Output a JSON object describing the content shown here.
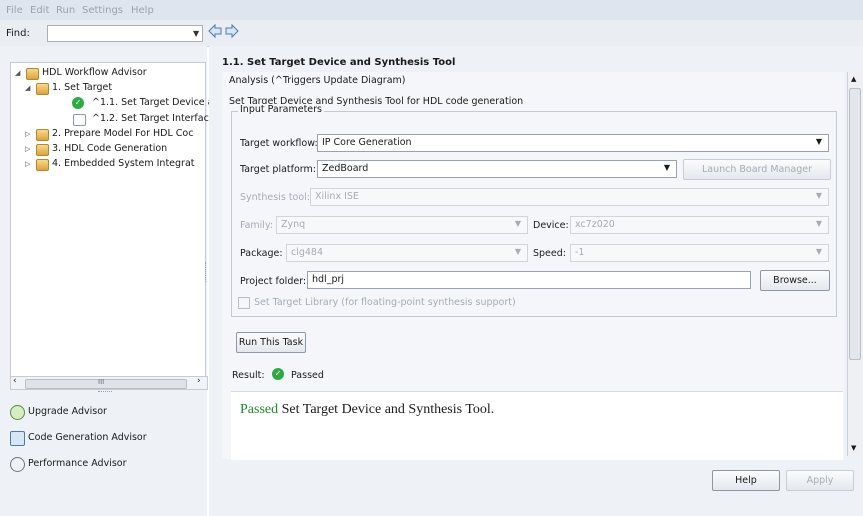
{
  "menu": {
    "items": [
      "File",
      "Edit",
      "Run",
      "Settings",
      "Help"
    ]
  },
  "find": {
    "label": "Find:",
    "value": ""
  },
  "tree": {
    "root": "HDL Workflow Advisor",
    "items": [
      {
        "label": "1. Set Target"
      },
      {
        "label": "^1.1. Set Target Device a"
      },
      {
        "label": "^1.2. Set Target Interfac"
      },
      {
        "label": "2. Prepare Model For HDL Coc"
      },
      {
        "label": "3. HDL Code Generation"
      },
      {
        "label": "4. Embedded System Integrat"
      }
    ],
    "scroll_marker": "III"
  },
  "advisors": [
    {
      "label": "Upgrade Advisor"
    },
    {
      "label": "Code Generation Advisor"
    },
    {
      "label": "Performance Advisor"
    }
  ],
  "task": {
    "title": "1.1. Set Target Device and Synthesis Tool",
    "analysis": "Analysis (^Triggers Update Diagram)",
    "description": "Set Target Device and Synthesis Tool for HDL code generation",
    "group_title": "Input Parameters"
  },
  "params": {
    "target_workflow": {
      "label": "Target workflow:",
      "value": "IP Core Generation"
    },
    "target_platform": {
      "label": "Target platform:",
      "value": "ZedBoard"
    },
    "launch_board_manager": "Launch Board Manager",
    "synthesis_tool": {
      "label": "Synthesis tool:",
      "value": "Xilinx ISE"
    },
    "family": {
      "label": "Family:",
      "value": "Zynq"
    },
    "device": {
      "label": "Device:",
      "value": "xc7z020"
    },
    "package": {
      "label": "Package:",
      "value": "clg484"
    },
    "speed": {
      "label": "Speed:",
      "value": "-1"
    },
    "project_folder": {
      "label": "Project folder:",
      "value": "hdl_prj"
    },
    "browse": "Browse...",
    "target_library": "Set Target Library (for floating-point synthesis support)"
  },
  "run_button": "Run This Task",
  "result": {
    "label": "Result:",
    "status": "Passed",
    "message_status": "Passed",
    "message_text": "Set Target Device and Synthesis Tool."
  },
  "footer": {
    "help": "Help",
    "apply": "Apply"
  },
  "colors": {
    "pass_green": "#2eaa43",
    "message_green": "#1f8a2b"
  }
}
